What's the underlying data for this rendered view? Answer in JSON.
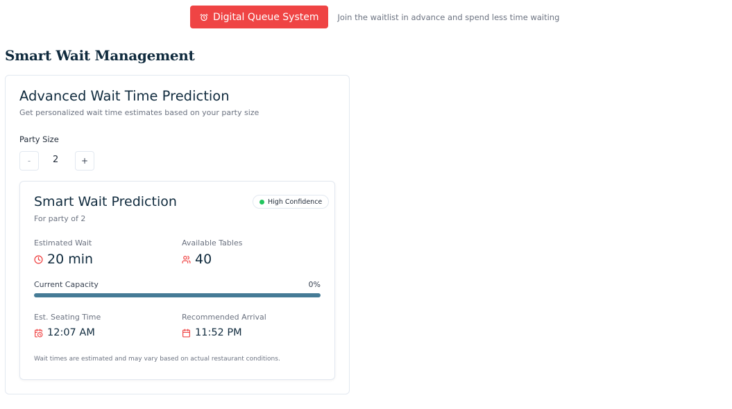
{
  "header": {
    "button_label": "Digital Queue System",
    "button_icon": "alarm-clock-icon",
    "tagline": "Join the waitlist in advance and spend less time waiting"
  },
  "section": {
    "title": "Smart Wait Management"
  },
  "prediction_form": {
    "title": "Advanced Wait Time Prediction",
    "subtitle": "Get personalized wait time estimates based on your party size",
    "party_size_label": "Party Size",
    "party_size_value": "2",
    "decrement_label": "-",
    "increment_label": "+"
  },
  "prediction_result": {
    "title": "Smart Wait Prediction",
    "subtitle": "For party of 2",
    "confidence_badge": "High Confidence",
    "estimated_wait_label": "Estimated Wait",
    "estimated_wait_value": "20 min",
    "available_tables_label": "Available Tables",
    "available_tables_value": "40",
    "capacity_label": "Current Capacity",
    "capacity_text": "0%",
    "capacity_fraction": 0,
    "seating_time_label": "Est. Seating Time",
    "seating_time_value": "12:07 AM",
    "recommended_arrival_label": "Recommended Arrival",
    "recommended_arrival_value": "11:52 PM",
    "footnote": "Wait times are estimated and may vary based on actual restaurant conditions."
  },
  "colors": {
    "accent_red": "#ef4444",
    "dark_navy": "#0f2a3d",
    "progress_bar": "#457b96",
    "confidence_green": "#22c55e"
  }
}
